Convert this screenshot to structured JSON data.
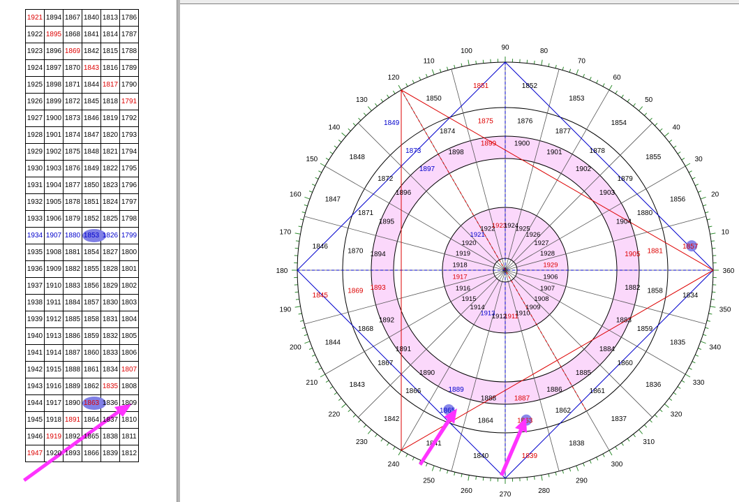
{
  "table": {
    "rows": [
      [
        {
          "t": "1921",
          "c": "red"
        },
        {
          "t": "1894"
        },
        {
          "t": "1867"
        },
        {
          "t": "1840"
        },
        {
          "t": "1813"
        },
        {
          "t": "1786"
        }
      ],
      [
        {
          "t": "1922"
        },
        {
          "t": "1895",
          "c": "red"
        },
        {
          "t": "1868"
        },
        {
          "t": "1841"
        },
        {
          "t": "1814"
        },
        {
          "t": "1787"
        }
      ],
      [
        {
          "t": "1923"
        },
        {
          "t": "1896"
        },
        {
          "t": "1869",
          "c": "red"
        },
        {
          "t": "1842"
        },
        {
          "t": "1815"
        },
        {
          "t": "1788"
        }
      ],
      [
        {
          "t": "1924"
        },
        {
          "t": "1897"
        },
        {
          "t": "1870"
        },
        {
          "t": "1843",
          "c": "red"
        },
        {
          "t": "1816"
        },
        {
          "t": "1789"
        }
      ],
      [
        {
          "t": "1925"
        },
        {
          "t": "1898"
        },
        {
          "t": "1871"
        },
        {
          "t": "1844"
        },
        {
          "t": "1817",
          "c": "red"
        },
        {
          "t": "1790"
        }
      ],
      [
        {
          "t": "1926"
        },
        {
          "t": "1899"
        },
        {
          "t": "1872"
        },
        {
          "t": "1845"
        },
        {
          "t": "1818"
        },
        {
          "t": "1791",
          "c": "red"
        }
      ],
      [
        {
          "t": "1927"
        },
        {
          "t": "1900"
        },
        {
          "t": "1873"
        },
        {
          "t": "1846"
        },
        {
          "t": "1819"
        },
        {
          "t": "1792"
        }
      ],
      [
        {
          "t": "1928"
        },
        {
          "t": "1901"
        },
        {
          "t": "1874"
        },
        {
          "t": "1847"
        },
        {
          "t": "1820"
        },
        {
          "t": "1793"
        }
      ],
      [
        {
          "t": "1929"
        },
        {
          "t": "1902"
        },
        {
          "t": "1875"
        },
        {
          "t": "1848"
        },
        {
          "t": "1821"
        },
        {
          "t": "1794"
        }
      ],
      [
        {
          "t": "1930"
        },
        {
          "t": "1903"
        },
        {
          "t": "1876"
        },
        {
          "t": "1849"
        },
        {
          "t": "1822"
        },
        {
          "t": "1795"
        }
      ],
      [
        {
          "t": "1931"
        },
        {
          "t": "1904"
        },
        {
          "t": "1877"
        },
        {
          "t": "1850"
        },
        {
          "t": "1823"
        },
        {
          "t": "1796"
        }
      ],
      [
        {
          "t": "1932"
        },
        {
          "t": "1905"
        },
        {
          "t": "1878"
        },
        {
          "t": "1851"
        },
        {
          "t": "1824"
        },
        {
          "t": "1797"
        }
      ],
      [
        {
          "t": "1933"
        },
        {
          "t": "1906"
        },
        {
          "t": "1879"
        },
        {
          "t": "1852"
        },
        {
          "t": "1825"
        },
        {
          "t": "1798"
        }
      ],
      [
        {
          "t": "1934",
          "c": "blue"
        },
        {
          "t": "1907",
          "c": "blue"
        },
        {
          "t": "1880",
          "c": "blue"
        },
        {
          "t": "1853",
          "c": "blue",
          "hl": true
        },
        {
          "t": "1826",
          "c": "blue"
        },
        {
          "t": "1799",
          "c": "blue"
        }
      ],
      [
        {
          "t": "1935"
        },
        {
          "t": "1908"
        },
        {
          "t": "1881"
        },
        {
          "t": "1854"
        },
        {
          "t": "1827"
        },
        {
          "t": "1800"
        }
      ],
      [
        {
          "t": "1936"
        },
        {
          "t": "1909"
        },
        {
          "t": "1882"
        },
        {
          "t": "1855"
        },
        {
          "t": "1828"
        },
        {
          "t": "1801"
        }
      ],
      [
        {
          "t": "1937"
        },
        {
          "t": "1910"
        },
        {
          "t": "1883"
        },
        {
          "t": "1856"
        },
        {
          "t": "1829"
        },
        {
          "t": "1802"
        }
      ],
      [
        {
          "t": "1938"
        },
        {
          "t": "1911"
        },
        {
          "t": "1884"
        },
        {
          "t": "1857"
        },
        {
          "t": "1830"
        },
        {
          "t": "1803"
        }
      ],
      [
        {
          "t": "1939"
        },
        {
          "t": "1912"
        },
        {
          "t": "1885"
        },
        {
          "t": "1858"
        },
        {
          "t": "1831"
        },
        {
          "t": "1804"
        }
      ],
      [
        {
          "t": "1940"
        },
        {
          "t": "1913"
        },
        {
          "t": "1886"
        },
        {
          "t": "1859"
        },
        {
          "t": "1832"
        },
        {
          "t": "1805"
        }
      ],
      [
        {
          "t": "1941"
        },
        {
          "t": "1914"
        },
        {
          "t": "1887"
        },
        {
          "t": "1860"
        },
        {
          "t": "1833"
        },
        {
          "t": "1806"
        }
      ],
      [
        {
          "t": "1942"
        },
        {
          "t": "1915"
        },
        {
          "t": "1888"
        },
        {
          "t": "1861"
        },
        {
          "t": "1834"
        },
        {
          "t": "1807",
          "c": "red"
        }
      ],
      [
        {
          "t": "1943"
        },
        {
          "t": "1916"
        },
        {
          "t": "1889"
        },
        {
          "t": "1862"
        },
        {
          "t": "1835",
          "c": "red"
        },
        {
          "t": "1808"
        }
      ],
      [
        {
          "t": "1944"
        },
        {
          "t": "1917"
        },
        {
          "t": "1890"
        },
        {
          "t": "1863",
          "c": "red",
          "hl": true
        },
        {
          "t": "1836"
        },
        {
          "t": "1809"
        }
      ],
      [
        {
          "t": "1945"
        },
        {
          "t": "1918"
        },
        {
          "t": "1891",
          "c": "red"
        },
        {
          "t": "1864"
        },
        {
          "t": "1837"
        },
        {
          "t": "1810"
        }
      ],
      [
        {
          "t": "1946"
        },
        {
          "t": "1919",
          "c": "red"
        },
        {
          "t": "1892"
        },
        {
          "t": "1865"
        },
        {
          "t": "1838"
        },
        {
          "t": "1811"
        }
      ],
      [
        {
          "t": "1947",
          "c": "red"
        },
        {
          "t": "1920"
        },
        {
          "t": "1893"
        },
        {
          "t": "1866"
        },
        {
          "t": "1839"
        },
        {
          "t": "1812"
        }
      ]
    ]
  },
  "wheel": {
    "degree_labels": [
      "10",
      "20",
      "30",
      "40",
      "50",
      "60",
      "70",
      "80",
      "90",
      "100",
      "110",
      "120",
      "130",
      "140",
      "150",
      "160",
      "170",
      "180",
      "190",
      "200",
      "210",
      "220",
      "230",
      "240",
      "250",
      "260",
      "270",
      "280",
      "290",
      "300",
      "310",
      "320",
      "330",
      "340",
      "350",
      "360"
    ],
    "outer_ring": [
      "1834",
      "1835",
      "1836",
      "1837",
      "1838",
      "1839",
      "1840",
      "1841",
      "1842",
      "1843",
      "1844",
      "1845",
      "1846",
      "1847",
      "1848",
      "1849",
      "1850",
      "1851",
      "1852",
      "1853",
      "1854",
      "1855",
      "1856",
      "1857"
    ],
    "ring3": [
      "1858",
      "1859",
      "1860",
      "1861",
      "1862",
      "1863",
      "1864",
      "1865",
      "1866",
      "1867",
      "1868",
      "1869",
      "1870",
      "1871",
      "1872",
      "1873",
      "1874",
      "1875",
      "1876",
      "1877",
      "1878",
      "1879",
      "1880",
      "1881"
    ],
    "ring2": [
      "1882",
      "1883",
      "1884",
      "1885",
      "1886",
      "1887",
      "1888",
      "1889",
      "1890",
      "1891",
      "1892",
      "1893",
      "1894",
      "1895",
      "1896",
      "1897",
      "1898",
      "1899",
      "1900",
      "1901",
      "1902",
      "1903",
      "1904",
      "1905"
    ],
    "inner_ring": [
      "1906",
      "1907",
      "1908",
      "1909",
      "1910",
      "1911",
      "1912",
      "1913",
      "1914",
      "1915",
      "1916",
      "1917",
      "1918",
      "1919",
      "1920",
      "1921",
      "1922",
      "1923",
      "1924",
      "1925",
      "1926",
      "1927",
      "1928",
      "1929"
    ],
    "red_years": [
      "1839",
      "1845",
      "1851",
      "1857",
      "1863",
      "1869",
      "1875",
      "1881",
      "1887",
      "1893",
      "1899",
      "1905",
      "1911",
      "1917",
      "1923",
      "1929"
    ],
    "blue_years": [
      "1849",
      "1865",
      "1873",
      "1889",
      "1897",
      "1913",
      "1921"
    ],
    "highlighted_years": [
      "1857",
      "1863",
      "1865"
    ],
    "colors": {
      "red": "#dd0000",
      "blue": "#0000cc",
      "pink_band": "#fbd8fb",
      "tick_green": "#2e8b2e",
      "arrow": "#ff33ff",
      "highlight": "#7b7be8"
    }
  }
}
